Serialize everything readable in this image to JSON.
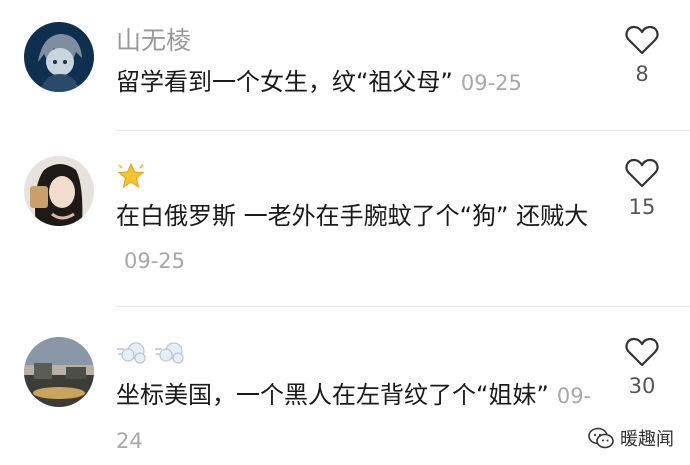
{
  "comments": [
    {
      "username": "山无棱",
      "text": "留学看到一个女生，纹“祖父母”",
      "date": "09-25",
      "likes": "8",
      "avatar_icon": "anime-character-avatar"
    },
    {
      "username": "",
      "emoji": [
        "star-emoji"
      ],
      "text": "在白俄罗斯 一老外在手腕蚊了个“狗” 还贼大",
      "date": "09-25",
      "likes": "15",
      "avatar_icon": "girl-photo-avatar"
    },
    {
      "username": "",
      "emoji": [
        "dash-emoji",
        "dash-emoji"
      ],
      "text": "坐标美国，一个黑人在左背纹了个“姐妹”",
      "date": "09-24",
      "likes": "30",
      "avatar_icon": "sunset-landscape-avatar"
    }
  ],
  "watermark": {
    "text": "暖趣闻",
    "icon": "wechat-icon"
  }
}
